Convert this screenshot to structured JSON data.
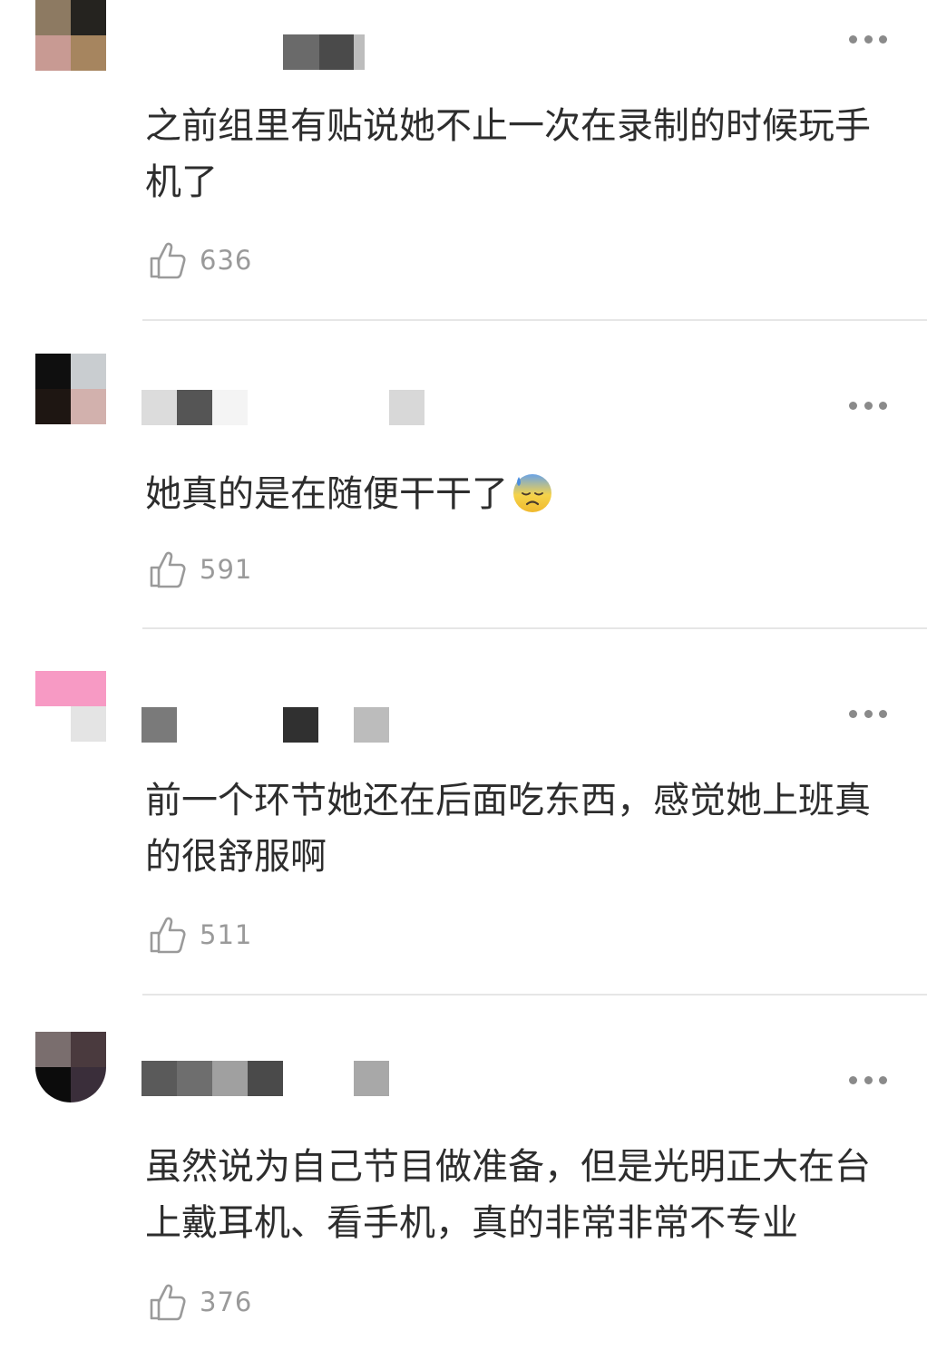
{
  "comments": [
    {
      "text": "之前组里有贴说她不止一次在录制的时候玩手机了",
      "likes": "636",
      "like_icon": "thumbs-up-icon",
      "more_icon": "more-icon"
    },
    {
      "text": "她真的是在随便干干了",
      "emoji": "downcast-face-with-sweat-emoji",
      "likes": "591",
      "like_icon": "thumbs-up-icon",
      "more_icon": "more-icon"
    },
    {
      "text": "前一个环节她还在后面吃东西，感觉她上班真的很舒服啊",
      "likes": "511",
      "like_icon": "thumbs-up-icon",
      "more_icon": "more-icon"
    },
    {
      "text": "虽然说为自己节目做准备，但是光明正大在台上戴耳机、看手机，真的非常非常不专业",
      "likes": "376",
      "like_icon": "thumbs-up-icon",
      "more_icon": "more-icon"
    }
  ],
  "colors": {
    "text": "#2d2d2d",
    "count": "#9a9a9a",
    "divider": "#e6e6e6",
    "dots": "#8a8a8a"
  }
}
